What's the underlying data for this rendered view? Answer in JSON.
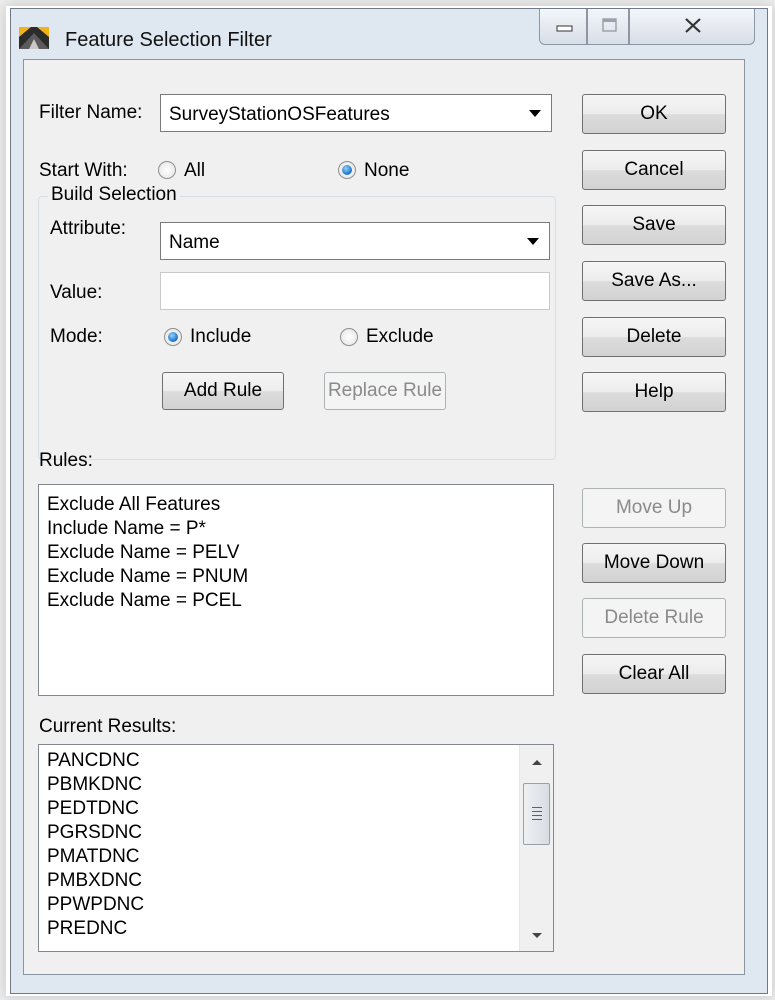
{
  "window": {
    "title": "Feature Selection Filter",
    "icon": "app-logo-icon"
  },
  "filter": {
    "name_label": "Filter Name:",
    "name_value": "SurveyStationOSFeatures"
  },
  "start_with": {
    "label": "Start With:",
    "option_all": "All",
    "option_none": "None",
    "selected": "None"
  },
  "build_selection": {
    "title": "Build Selection",
    "attribute_label": "Attribute:",
    "attribute_value": "Name",
    "value_label": "Value:",
    "value_text": "",
    "mode_label": "Mode:",
    "mode_include": "Include",
    "mode_exclude": "Exclude",
    "mode_selected": "Include",
    "add_rule": "Add Rule",
    "replace_rule": "Replace Rule"
  },
  "buttons": {
    "ok": "OK",
    "cancel": "Cancel",
    "save": "Save",
    "save_as": "Save As...",
    "delete": "Delete",
    "help": "Help",
    "move_up": "Move Up",
    "move_down": "Move Down",
    "delete_rule": "Delete Rule",
    "clear_all": "Clear All"
  },
  "rules": {
    "label": "Rules:",
    "items": [
      "Exclude All Features",
      "Include Name = P*",
      "Exclude Name = PELV",
      "Exclude Name = PNUM",
      "Exclude Name = PCEL"
    ]
  },
  "results": {
    "label": "Current Results:",
    "items": [
      "PANCDNC",
      "PBMKDNC",
      "PEDTDNC",
      "PGRSDNC",
      "PMATDNC",
      "PMBXDNC",
      "PPWPDNC",
      "PREDNC"
    ]
  }
}
